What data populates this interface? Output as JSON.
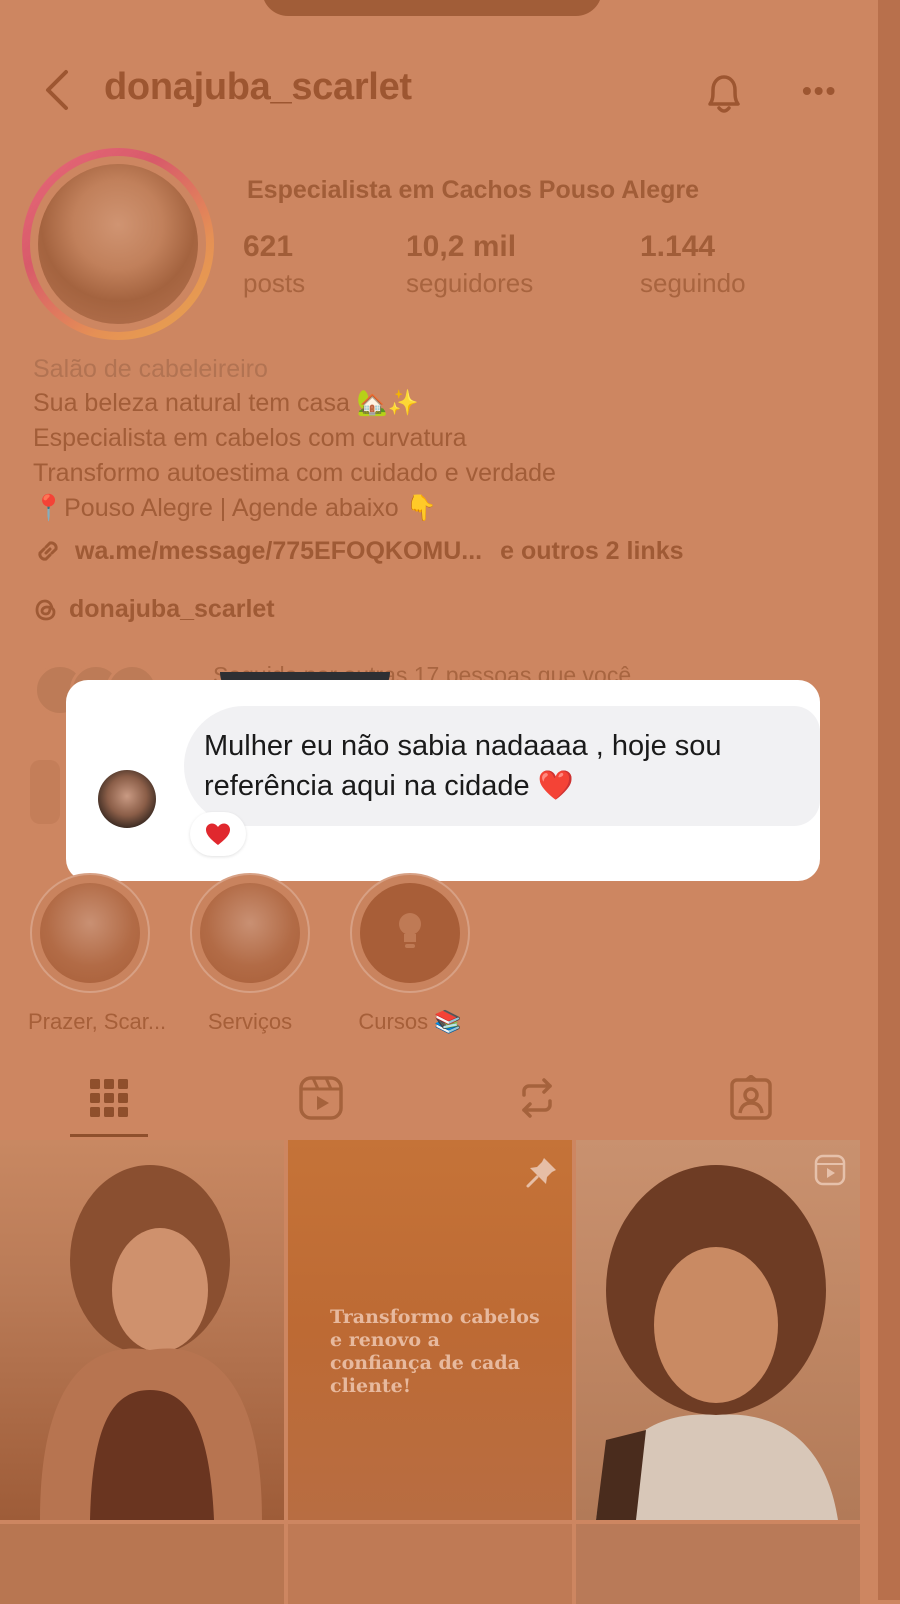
{
  "header": {
    "username": "donajuba_scarlet"
  },
  "profile": {
    "name": "Especialista em Cachos Pouso Alegre",
    "stats": [
      {
        "value": "621",
        "label": "posts"
      },
      {
        "value": "10,2 mil",
        "label": "seguidores"
      },
      {
        "value": "1.144",
        "label": "seguindo"
      }
    ],
    "category": "Salão de cabeleireiro",
    "bio": [
      "Sua beleza natural tem casa 🏡✨",
      "Especialista em cabelos com curvatura",
      "Transformo autoestima com cuidado e verdade",
      "📍Pouso Alegre | Agende abaixo 👇"
    ],
    "link_text": "wa.me/message/775EFOQKOMU...",
    "more_links": "e outros 2 links",
    "threads_handle": "donajuba_scarlet",
    "followed_by": "Seguido por outras 17 pessoas que você"
  },
  "comment": {
    "text": "Mulher eu não sabia nadaaaa , hoje sou referência aqui na cidade ❤️",
    "reaction": "❤️"
  },
  "highlights": [
    {
      "label": "Prazer, Scar..."
    },
    {
      "label": "Serviços"
    },
    {
      "label": "Cursos 📚"
    }
  ],
  "grid": {
    "pinned_post_text": "Transformo cabelos e renovo a confiança de cada cliente!"
  },
  "icons": {
    "back": "chevron-left-icon",
    "bell": "bell-icon",
    "more": "more-horizontal-icon",
    "link": "link-icon",
    "threads": "threads-icon",
    "tabs": [
      "grid-icon",
      "reels-icon",
      "repost-icon",
      "tagged-icon"
    ]
  },
  "colors": {
    "overlay_tint": "#cd8661",
    "card": "#ffffff",
    "bubble": "#f1f1f3",
    "heart": "#e0282e"
  }
}
